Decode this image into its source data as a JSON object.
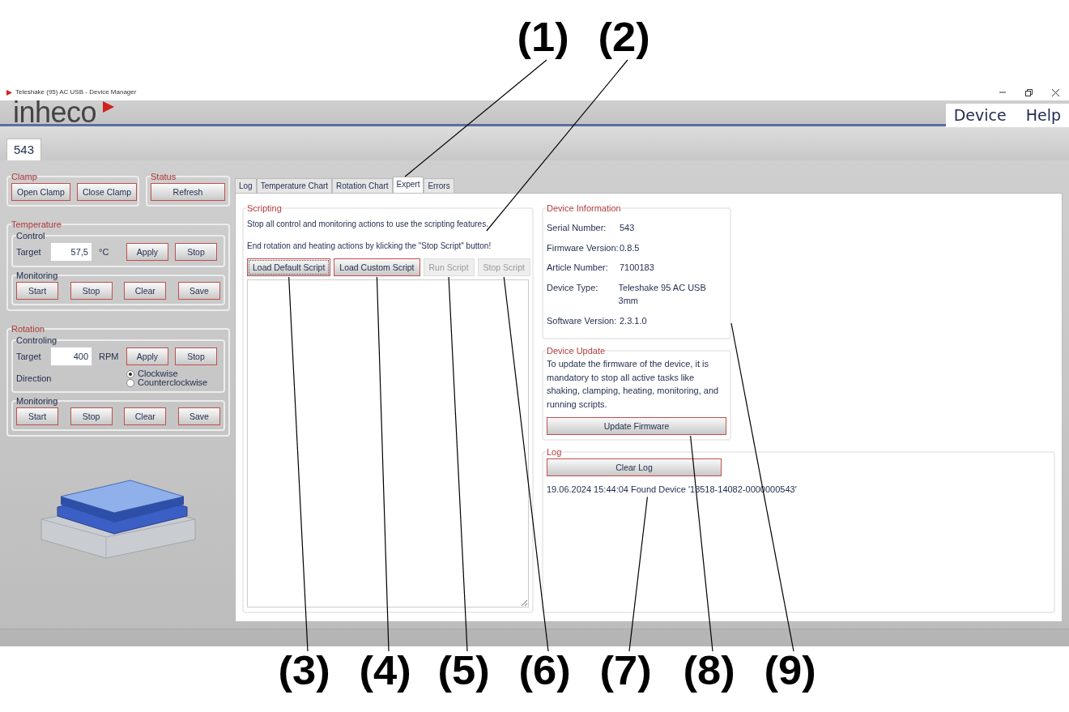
{
  "window": {
    "title": "Teleshake (95) AC USB - Device Manager"
  },
  "logo": {
    "text": "inheco"
  },
  "menu": [
    {
      "label": "Device"
    },
    {
      "label": "Help"
    }
  ],
  "device_tabs": [
    {
      "label": "543",
      "selected": true
    }
  ],
  "clamp": {
    "title": "Clamp",
    "buttons": [
      "Open Clamp",
      "Close Clamp"
    ]
  },
  "status": {
    "title": "Status",
    "buttons": [
      "Refresh"
    ]
  },
  "temperature": {
    "title": "Temperature",
    "control": {
      "title": "Control",
      "target_label": "Target",
      "value": "57,5",
      "unit": "°C",
      "buttons": [
        "Apply",
        "Stop"
      ]
    },
    "monitoring": {
      "title": "Monitoring",
      "buttons": [
        "Start",
        "Stop",
        "Clear",
        "Save"
      ]
    }
  },
  "rotation": {
    "title": "Rotation",
    "control": {
      "title": "Controling",
      "target_label": "Target",
      "value": "400",
      "unit": "RPM",
      "buttons": [
        "Apply",
        "Stop"
      ],
      "direction_label": "Direction",
      "directions": [
        {
          "label": "Clockwise",
          "selected": true
        },
        {
          "label": "Counterclockwise",
          "selected": false
        }
      ]
    },
    "monitoring": {
      "title": "Monitoring",
      "buttons": [
        "Start",
        "Stop",
        "Clear",
        "Save"
      ]
    }
  },
  "tabs": [
    {
      "label": "Log",
      "selected": false
    },
    {
      "label": "Temperature Chart",
      "selected": false
    },
    {
      "label": "Rotation Chart",
      "selected": false
    },
    {
      "label": "Expert",
      "selected": true
    },
    {
      "label": "Errors",
      "selected": false
    }
  ],
  "scripting": {
    "title": "Scripting",
    "notes": [
      "Stop all control and monitoring actions to use the scripting features.",
      "End rotation and heating actions by klicking the \"Stop Script\" button!"
    ],
    "buttons": [
      {
        "label": "Load Default Script",
        "disabled": false
      },
      {
        "label": "Load Custom Script",
        "disabled": false
      },
      {
        "label": "Run Script",
        "disabled": true
      },
      {
        "label": "Stop Script",
        "disabled": true
      }
    ]
  },
  "device_information": {
    "title": "Device Information",
    "rows": [
      {
        "label": "Serial Number:",
        "value": "543"
      },
      {
        "label": "Firmware Version:",
        "value": "0.8.5"
      },
      {
        "label": "Article Number:",
        "value": "7100183"
      },
      {
        "label": "Device Type:",
        "value": "Teleshake 95 AC USB 3mm"
      },
      {
        "label": "Software Version:",
        "value": "2.3.1.0"
      }
    ]
  },
  "device_update": {
    "title": "Device Update",
    "text": "To update the firmware of the device, it is mandatory to stop all active tasks like shaking, clamping, heating, monitoring, and running scripts.",
    "button": "Update Firmware"
  },
  "log": {
    "title": "Log",
    "button": "Clear Log",
    "entries": [
      "19.06.2024 15:44:04 Found Device '13518-14082-0000000543'"
    ]
  },
  "callouts": [
    "(1)",
    "(2)",
    "(3)",
    "(4)",
    "(5)",
    "(6)",
    "(7)",
    "(8)",
    "(9)"
  ]
}
